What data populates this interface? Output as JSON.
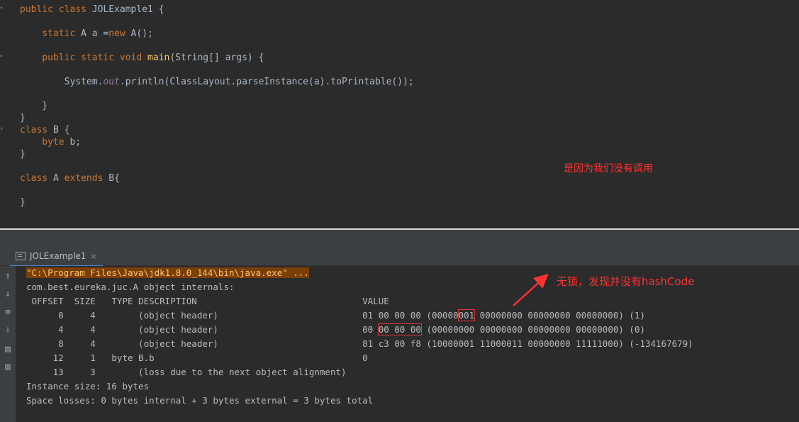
{
  "editor": {
    "lines": [
      {
        "parts": [
          {
            "t": "public class ",
            "c": "kw"
          },
          {
            "t": "JOLExample1",
            "c": "cls"
          },
          {
            "t": " {",
            "c": "cls"
          }
        ]
      },
      {
        "parts": [
          {
            "t": "    static ",
            "c": "kw"
          },
          {
            "t": "A a =",
            "c": "cls"
          },
          {
            "t": "new ",
            "c": "kw"
          },
          {
            "t": "A();",
            "c": "cls"
          }
        ]
      },
      {
        "parts": [
          {
            "t": "    public static void ",
            "c": "kw"
          },
          {
            "t": "main",
            "c": "mth"
          },
          {
            "t": "(String[] args) {",
            "c": "cls"
          }
        ]
      },
      {
        "parts": [
          {
            "t": "        System.",
            "c": "cls"
          },
          {
            "t": "out",
            "c": "it"
          },
          {
            "t": ".println(ClassLayout.",
            "c": "cls"
          },
          {
            "t": "parseInstance",
            "c": "cls"
          },
          {
            "t": "(a).",
            "c": "cls"
          },
          {
            "t": "toPrintable",
            "c": "cls"
          },
          {
            "t": "());",
            "c": "cls"
          }
        ]
      },
      {
        "parts": [
          {
            "t": "    }",
            "c": "cls"
          }
        ]
      },
      {
        "parts": [
          {
            "t": "}",
            "c": "cls"
          }
        ]
      },
      {
        "parts": [
          {
            "t": "class ",
            "c": "kw"
          },
          {
            "t": "B {",
            "c": "cls"
          }
        ]
      },
      {
        "parts": [
          {
            "t": "    byte ",
            "c": "kw"
          },
          {
            "t": "b;",
            "c": "cls"
          }
        ]
      },
      {
        "parts": [
          {
            "t": "}",
            "c": "cls"
          }
        ]
      },
      {
        "parts": [
          {
            "t": "class ",
            "c": "kw"
          },
          {
            "t": "A ",
            "c": "cls"
          },
          {
            "t": "extends ",
            "c": "kw"
          },
          {
            "t": "B{",
            "c": "cls"
          }
        ]
      },
      {
        "parts": [
          {
            "t": "}",
            "c": "cls"
          }
        ]
      }
    ],
    "annotation": "是因为我们没有调用"
  },
  "run_panel": {
    "tab_label": "JOLExample1",
    "tab_close": "×",
    "icons": [
      "up-arrow-icon",
      "down-arrow-icon",
      "soft-wrap-icon",
      "scroll-to-end-icon",
      "print-icon",
      "trash-icon"
    ]
  },
  "console": {
    "command": "\"C:\\Program Files\\Java\\jdk1.8.0_144\\bin\\java.exe\" ...",
    "object_title": "com.best.eureka.juc.A object internals:",
    "header": " OFFSET  SIZE   TYPE DESCRIPTION                               VALUE",
    "rows": [
      {
        "prefix": "      0     4        (object header)                           01 00 00 00 (00000",
        "boxed": "001",
        "suffix": " 00000000 00000000 00000000) (1)"
      },
      {
        "prefix": "      4     4        (object header)                           00 ",
        "boxed": "00 00 00",
        "suffix": " (00000000 00000000 00000000 00000000) (0)"
      },
      {
        "prefix": "      8     4        (object header)                           81 c3 00 f8 (10000001 11000011 00000000 11111000) (-134167679)",
        "boxed": "",
        "suffix": ""
      },
      {
        "prefix": "     12     1   byte B.b                                       0",
        "boxed": "",
        "suffix": ""
      },
      {
        "prefix": "     13     3        (loss due to the next object alignment)",
        "boxed": "",
        "suffix": ""
      }
    ],
    "instance_size": "Instance size: 16 bytes",
    "space_losses": "Space losses: 0 bytes internal + 3 bytes external = 3 bytes total",
    "annotation": "无锁，发现并没有hashCode"
  }
}
